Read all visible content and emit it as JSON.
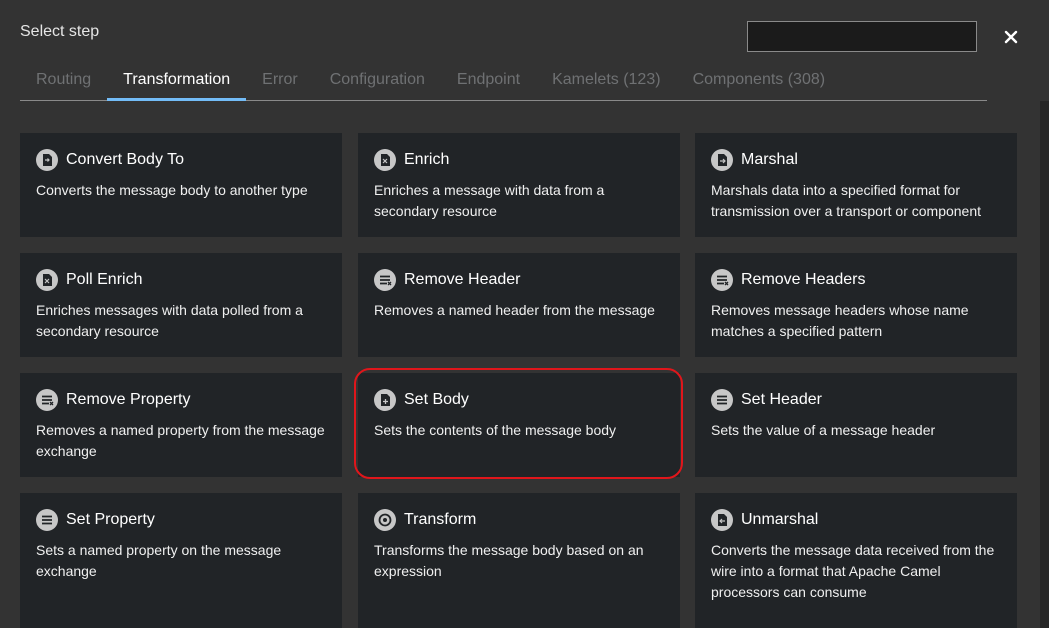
{
  "dialog": {
    "title": "Select step",
    "search": {
      "value": "",
      "placeholder": ""
    },
    "close_icon": "close-icon"
  },
  "tabs": [
    {
      "label": "Routing",
      "active": false
    },
    {
      "label": "Transformation",
      "active": true
    },
    {
      "label": "Error",
      "active": false
    },
    {
      "label": "Configuration",
      "active": false
    },
    {
      "label": "Endpoint",
      "active": false
    },
    {
      "label": "Kamelets (123)",
      "active": false
    },
    {
      "label": "Components (308)",
      "active": false
    }
  ],
  "cards": [
    {
      "title": "Convert Body To",
      "description": "Converts the message body to another type",
      "icon": "file-convert-icon"
    },
    {
      "title": "Enrich",
      "description": "Enriches a message with data from a secondary resource",
      "icon": "file-enrich-icon"
    },
    {
      "title": "Marshal",
      "description": "Marshals data into a specified format for transmission over a transport or component",
      "icon": "file-export-icon"
    },
    {
      "title": "Poll Enrich",
      "description": "Enriches messages with data polled from a secondary resource",
      "icon": "file-enrich-icon"
    },
    {
      "title": "Remove Header",
      "description": "Removes a named header from the message",
      "icon": "list-remove-icon"
    },
    {
      "title": "Remove Headers",
      "description": "Removes message headers whose name matches a specified pattern",
      "icon": "list-remove-icon"
    },
    {
      "title": "Remove Property",
      "description": "Removes a named property from the message exchange",
      "icon": "list-remove-icon"
    },
    {
      "title": "Set Body",
      "description": "Sets the contents of the message body",
      "icon": "file-add-icon",
      "highlighted": true
    },
    {
      "title": "Set Header",
      "description": "Sets the value of a message header",
      "icon": "list-set-icon"
    },
    {
      "title": "Set Property",
      "description": "Sets a named property on the message exchange",
      "icon": "list-set-icon"
    },
    {
      "title": "Transform",
      "description": "Transforms the message body based on an expression",
      "icon": "transform-icon"
    },
    {
      "title": "Unmarshal",
      "description": "Converts the message data received from the wire into a format that Apache Camel processors can consume",
      "icon": "file-import-icon"
    }
  ],
  "colors": {
    "background": "#333333",
    "card": "#212427",
    "tab_active_underline": "#73bcf7",
    "highlight": "#e0161b"
  }
}
